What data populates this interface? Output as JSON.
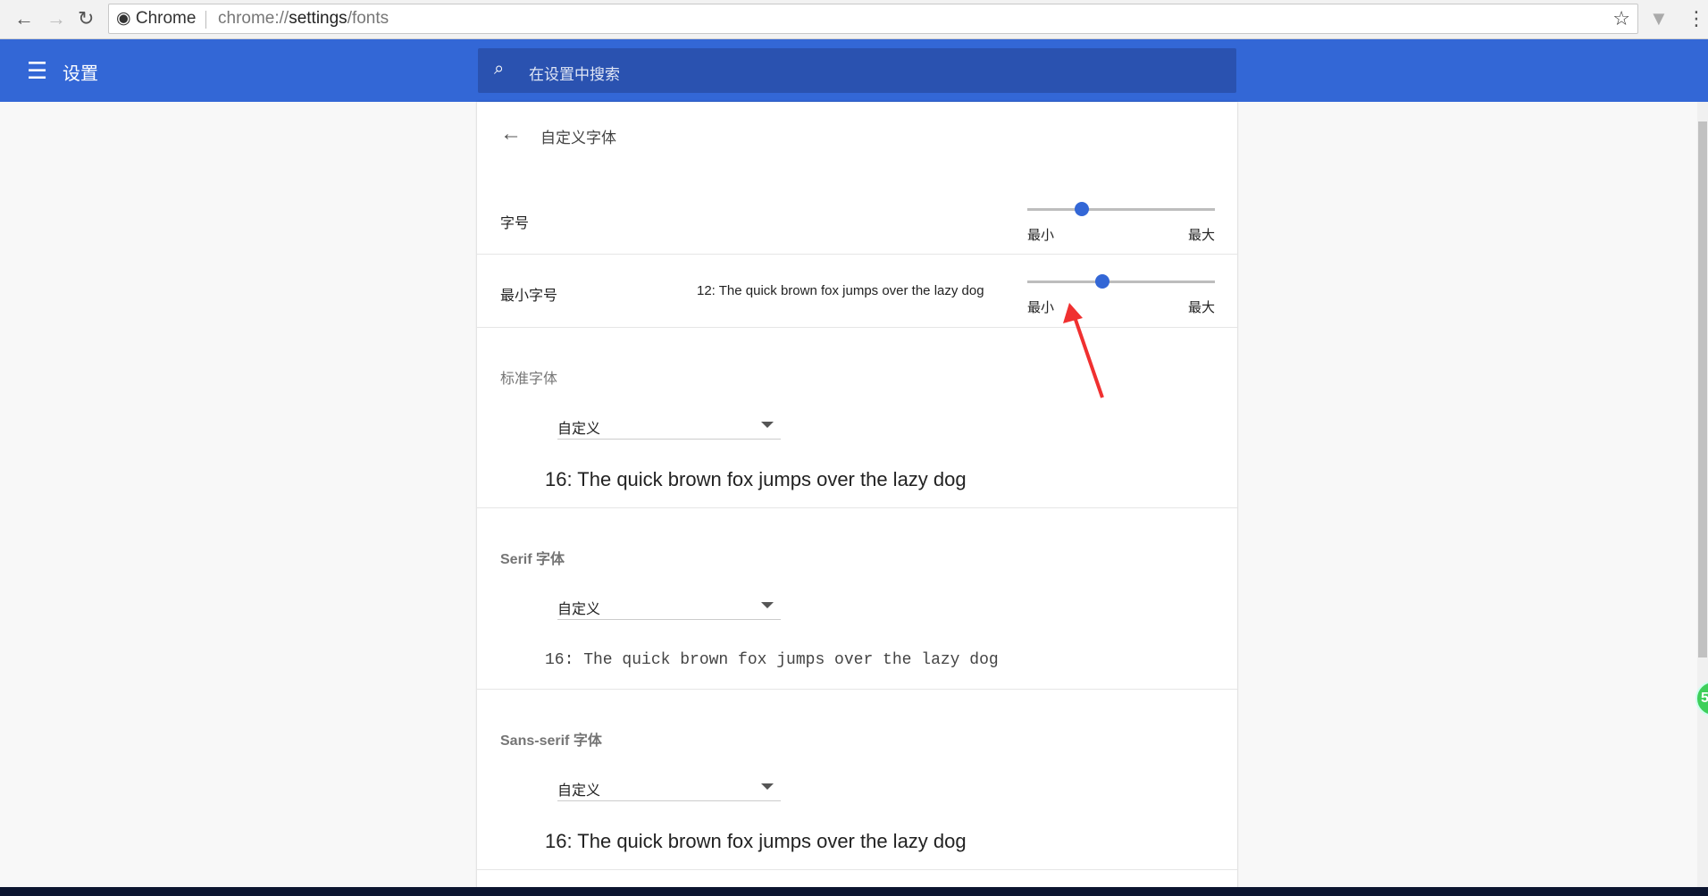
{
  "browser": {
    "site_label": "Chrome",
    "url_prefix": "chrome://",
    "url_host": "settings",
    "url_path": "/fonts"
  },
  "header": {
    "title": "设置",
    "search_placeholder": "在设置中搜索"
  },
  "page": {
    "title": "自定义字体",
    "font_size": {
      "label": "字号",
      "min_label": "最小",
      "max_label": "最大",
      "value_fraction": 0.29
    },
    "min_font_size": {
      "label": "最小字号",
      "sample": "12: The quick brown fox jumps over the lazy dog",
      "min_label": "最小",
      "max_label": "最大",
      "value_fraction": 0.4
    },
    "standard_font": {
      "label": "标准字体",
      "selected": "自定义",
      "sample": "16: The quick brown fox jumps over the lazy dog"
    },
    "serif_font": {
      "label": "Serif 字体",
      "selected": "自定义",
      "sample": "16: The quick brown fox jumps over the lazy dog"
    },
    "sans_serif_font": {
      "label": "Sans-serif 字体",
      "selected": "自定义",
      "sample": "16: The quick brown fox jumps over the lazy dog"
    }
  },
  "overlay": {
    "badge_text": "5"
  },
  "colors": {
    "accent": "#3367d6",
    "annotation_arrow": "#f03030"
  }
}
